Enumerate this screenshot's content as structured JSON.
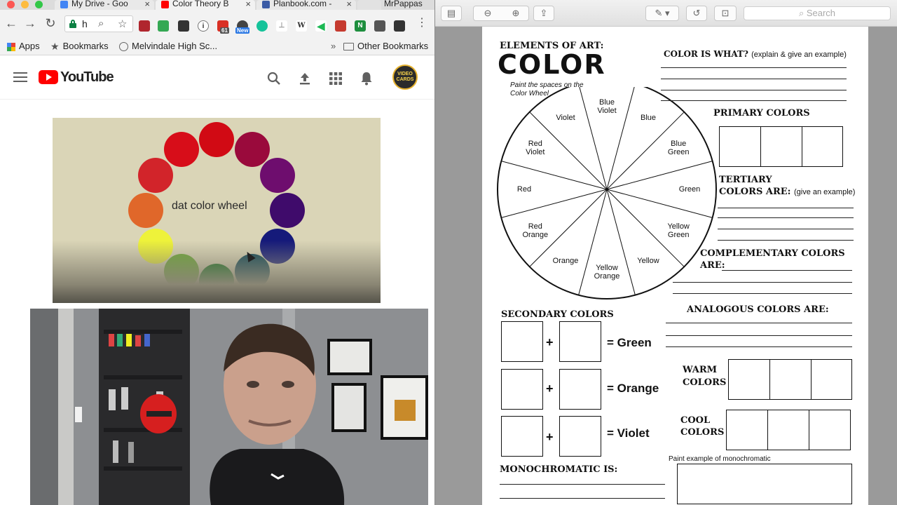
{
  "browser": {
    "tabs": [
      {
        "title": "My Drive - Goo",
        "color": "#4285f4"
      },
      {
        "title": "Color Theory B",
        "color": "#ff0000"
      },
      {
        "title": "Planbook.com -",
        "color": "#3b5ba5"
      },
      {
        "title": "",
        "color": "#dddddd"
      }
    ],
    "profile_name": "MrPappas",
    "address": "h",
    "bookmarks": [
      {
        "label": "Apps"
      },
      {
        "label": "Bookmarks"
      },
      {
        "label": "Melvindale High Sc..."
      }
    ],
    "other_bookmarks": "Other Bookmarks",
    "ext_badges": {
      "count": "61",
      "new": "New"
    }
  },
  "youtube": {
    "logo_text": "YouTube",
    "avatar_text": "VIDEO CARDS",
    "video_label": "dat color wheel",
    "wheel_colors": [
      "#d10a14",
      "#9a0a3c",
      "#6e0d6e",
      "#3f0b6b",
      "#151a7a",
      "#0d4555",
      "#0d6e1a",
      "#6ba736",
      "#eef23a",
      "#e0672a",
      "#d2242a",
      "#d70d19"
    ]
  },
  "preview": {
    "search_placeholder": "Search"
  },
  "worksheet": {
    "title_small": "ELEMENTS OF ART:",
    "title_big": "COLOR",
    "wheel_hint": "Paint the spaces on the Color Wheel",
    "wheel_labels": [
      "Blue",
      "Blue Green",
      "Green",
      "Yellow Green",
      "Yellow",
      "Yellow Orange",
      "Orange",
      "Red Orange",
      "Red",
      "Red Violet",
      "Violet",
      "Blue Violet"
    ],
    "color_is_what": "COLOR IS WHAT?",
    "color_is_what_note": "(explain & give an example)",
    "primary": "PRIMARY COLORS",
    "tertiary": "TERTIARY",
    "tertiary_line2": "COLORS ARE:",
    "tertiary_note": "(give an example)",
    "complementary": "COMPLEMENTARY COLORS",
    "complementary_line2": "ARE:",
    "analogous": "ANALOGOUS COLORS ARE:",
    "secondary": "SECONDARY COLORS",
    "secondary_results": [
      "= Green",
      "= Orange",
      "= Violet"
    ],
    "plus": "+",
    "warm": "WARM",
    "warm_line2": "COLORS",
    "cool": "COOL",
    "cool_line2": "COLORS",
    "monochromatic": "MONOCHROMATIC IS:",
    "mono_example": "Paint example of monochromatic"
  }
}
